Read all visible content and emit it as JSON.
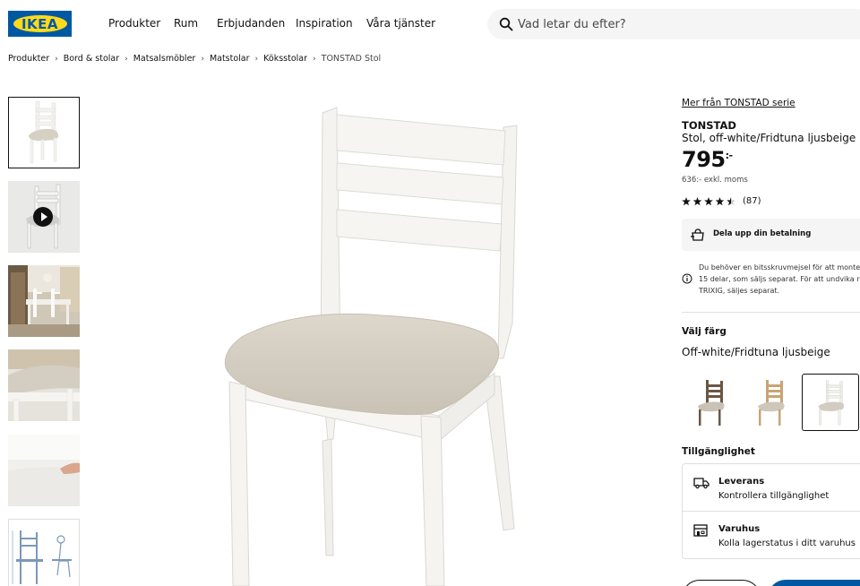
{
  "header": {
    "logo_text": "IKEA",
    "nav": [
      "Produkter",
      "Rum",
      "Erbjudanden",
      "Inspiration",
      "Våra tjänster"
    ],
    "search_placeholder": "Vad letar du efter?"
  },
  "breadcrumb": [
    "Produkter",
    "Bord & stolar",
    "Matsalsmöbler",
    "Matstolar",
    "Köksstolar",
    "TONSTAD Stol"
  ],
  "gallery": {
    "thumbnails": [
      "chair-front",
      "chair-video",
      "dining-room",
      "seat-closeup",
      "foam-closeup",
      "dimensions-drawing"
    ],
    "active_index": 0
  },
  "product": {
    "series_link": "Mer från TONSTAD serie",
    "name": "TONSTAD",
    "description": "Stol, off-white/Fridtuna ljusbeige",
    "price": "795",
    "price_suffix": ":-",
    "price_ex_vat": "636:- exkl. moms",
    "rating": 4.5,
    "rating_count": "(87)",
    "payment_label": "Dela upp din betalning",
    "info_lines": [
      "Du behöver en bitsskruvmejsel för att monte",
      "15 delar, som säljs separat. För att undvika re",
      "TRIXIG, säljes separat."
    ]
  },
  "color": {
    "label": "Välj färg",
    "value": "Off-white/Fridtuna ljusbeige",
    "swatches": [
      "brown",
      "oak",
      "off-white"
    ],
    "selected_index": 2
  },
  "availability": {
    "label": "Tillgänglighet",
    "delivery_title": "Leverans",
    "delivery_sub": "Kontrollera tillgänglighet",
    "store_title": "Varuhus",
    "store_sub": "Kolla lagerstatus i ditt varuhus"
  },
  "colors": {
    "ikea_blue": "#0058a3",
    "ikea_yellow": "#ffda1a",
    "text": "#111111",
    "muted": "#484848"
  }
}
